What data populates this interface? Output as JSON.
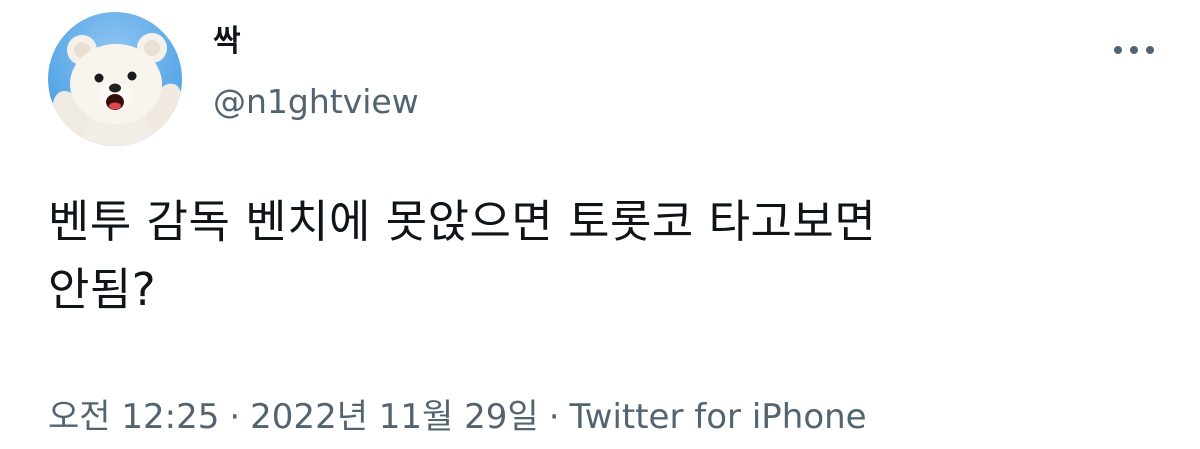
{
  "author": {
    "display_name": "싹",
    "handle": "@n1ghtview",
    "avatar_icon": "teddy-bear-avatar-icon"
  },
  "more_icon": "more-options-icon",
  "tweet": {
    "text": "벤투 감독 벤치에 못앉으면 토롯코 타고보면\n안됨?"
  },
  "meta": {
    "time": "오전 12:25",
    "separator": "·",
    "date": "2022년 11월 29일",
    "source": "Twitter for iPhone"
  },
  "colors": {
    "text": "#0f1419",
    "secondary": "#536471",
    "avatar_sky": "#3d97e0"
  }
}
